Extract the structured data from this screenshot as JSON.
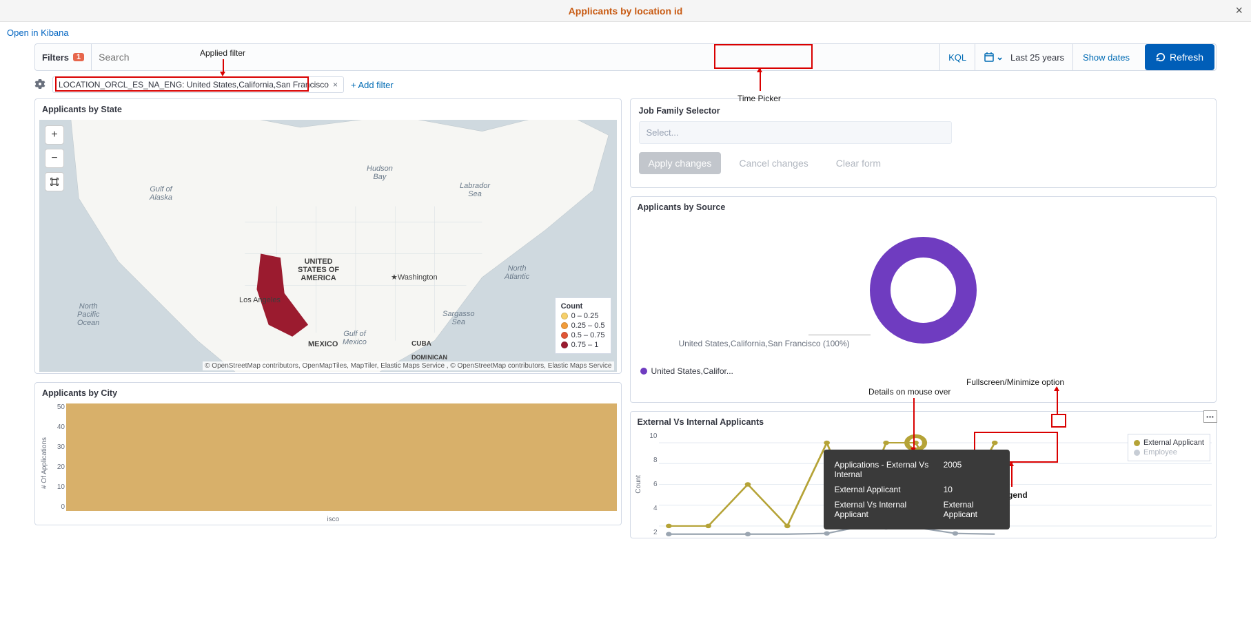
{
  "header": {
    "title": "Applicants by location id",
    "open_link": "Open in Kibana"
  },
  "query_bar": {
    "filters_label": "Filters",
    "filters_count": "1",
    "search_placeholder": "Search",
    "kql": "KQL",
    "time_range": "Last 25 years",
    "show_dates": "Show dates",
    "refresh": "Refresh"
  },
  "filter_row": {
    "pill": "LOCATION_ORCL_ES_NA_ENG: United States,California,San Francisco",
    "add_filter": "+ Add filter"
  },
  "panels": {
    "map": {
      "title": "Applicants by State",
      "legend_title": "Count",
      "legend_rows": [
        {
          "color": "#f7d06a",
          "label": "0 – 0.25"
        },
        {
          "color": "#f29c3a",
          "label": "0.25 – 0.5"
        },
        {
          "color": "#e15636",
          "label": "0.5 – 0.75"
        },
        {
          "color": "#9b1b2f",
          "label": "0.75 – 1"
        }
      ],
      "attribution": "© OpenStreetMap contributors, OpenMapTiles, MapTiler, Elastic Maps Service , © OpenStreetMap contributors, Elastic Maps Service",
      "labels": {
        "usa": "UNITED\nSTATES OF\nAMERICA",
        "mexico": "MEXICO",
        "cuba": "CUBA",
        "dominican": "DOMINICAN",
        "washington": "Washington",
        "los_angeles": "Los Angeles",
        "alaska": "Gulf of\nAlaska",
        "hudson": "Hudson\nBay",
        "labrador": "Labrador\nSea",
        "north_pac": "North\nPacific\nOcean",
        "gulf_mex": "Gulf of\nMexico",
        "sargasso": "Sargasso\nSea",
        "north_atl": "North\nAtlantic"
      }
    },
    "city": {
      "title": "Applicants by City",
      "y_title": "# Of Applications",
      "y_ticks": [
        "50",
        "40",
        "30",
        "20",
        "10",
        "0"
      ],
      "x_label": "isco"
    },
    "job": {
      "title": "Job Family Selector",
      "placeholder": "Select...",
      "apply": "Apply changes",
      "cancel": "Cancel changes",
      "clear": "Clear form"
    },
    "source": {
      "title": "Applicants by Source",
      "slice_label": "United States,California,San Francisco (100%)",
      "legend_item": "United States,Califor..."
    },
    "line": {
      "title": "External Vs Internal Applicants",
      "y_title": "Count",
      "y_ticks": [
        "10",
        "8",
        "6",
        "4",
        "2"
      ],
      "legend": [
        {
          "color": "#b5a337",
          "label": "External Applicant"
        },
        {
          "color": "#b8c2d0",
          "label": "Employee"
        }
      ],
      "tooltip": {
        "title": "Applications - External Vs Internal",
        "year": "2005",
        "r1_label": "External Applicant",
        "r1_val": "10",
        "r2_label": "External Vs Internal Applicant",
        "r2_val": "External Applicant"
      }
    }
  },
  "annotations": {
    "applied_filter": "Applied filter",
    "time_picker": "Time Picker",
    "details_mouseover": "Details on mouse over",
    "fullscreen": "Fullscreen/Minimize option",
    "legend": "Legend"
  },
  "chart_data": {
    "city_bar": {
      "type": "bar",
      "categories": [
        "San Francisco"
      ],
      "values": [
        50
      ],
      "ylabel": "# Of Applications",
      "ylim": [
        0,
        50
      ]
    },
    "source_pie": {
      "type": "pie",
      "series": [
        {
          "name": "United States,California,San Francisco",
          "value": 100
        }
      ]
    },
    "external_internal_line": {
      "type": "line",
      "x_visible_range": [
        1999,
        2010
      ],
      "ylim": [
        0,
        11
      ],
      "series": [
        {
          "name": "External Applicant",
          "color": "#b5a337",
          "values_sample": [
            2,
            2,
            6,
            2,
            10,
            3,
            10,
            10,
            3,
            10
          ]
        },
        {
          "name": "Employee",
          "color": "#9aa5b1",
          "values_sample": [
            1,
            1,
            1,
            1,
            1,
            2,
            2,
            2,
            1,
            1
          ]
        }
      ],
      "highlighted_point": {
        "series": "External Applicant",
        "x": 2005,
        "y": 10
      }
    }
  }
}
